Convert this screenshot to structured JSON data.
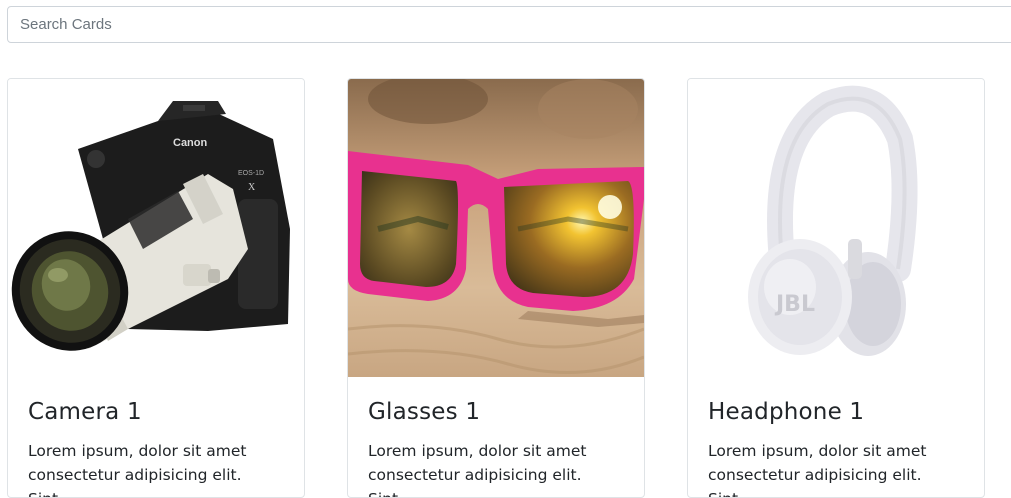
{
  "search": {
    "placeholder": "Search Cards"
  },
  "cards": [
    {
      "title": "Camera 1",
      "text": "Lorem ipsum, dolor sit amet consectetur adipisicing elit. Sint",
      "image_icon": "camera-photo"
    },
    {
      "title": "Glasses 1",
      "text": "Lorem ipsum, dolor sit amet consectetur adipisicing elit. Sint",
      "image_icon": "sunglasses-photo"
    },
    {
      "title": "Headphone 1",
      "text": "Lorem ipsum, dolor sit amet consectetur adipisicing elit. Sint",
      "image_icon": "headphones-photo"
    }
  ],
  "colors": {
    "card_border": "#dfe3e6",
    "input_border": "#ced4da",
    "glasses_frame": "#e8318f"
  }
}
